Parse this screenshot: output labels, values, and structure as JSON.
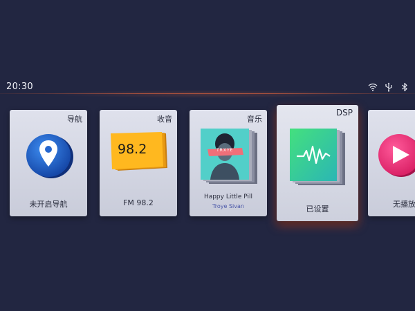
{
  "status_bar": {
    "time": "20:30",
    "icons": [
      "wifi-icon",
      "usb-icon",
      "bluetooth-icon"
    ]
  },
  "cards": {
    "navigation": {
      "title": "导航",
      "label": "未开启导航",
      "icon": "location-pin-icon"
    },
    "radio": {
      "title": "收音",
      "frequency_display": "98.2",
      "label": "FM 98.2"
    },
    "music": {
      "title": "音乐",
      "song": "Happy Little Pill",
      "artist": "Troye Sivan",
      "album_art_text": "TRXYE"
    },
    "dsp": {
      "title": "DSP",
      "label": "已设置",
      "icon": "sound-wave-icon"
    },
    "video": {
      "label": "无播放",
      "icon": "play-icon"
    }
  },
  "colors": {
    "background": "#222641",
    "accent": "#e1502a",
    "nav_blue": "#1e63c6",
    "radio_orange": "#ffb21a",
    "music_teal": "#4ecfc8",
    "dsp_green": "#3fd58a",
    "video_pink": "#f0367e"
  }
}
